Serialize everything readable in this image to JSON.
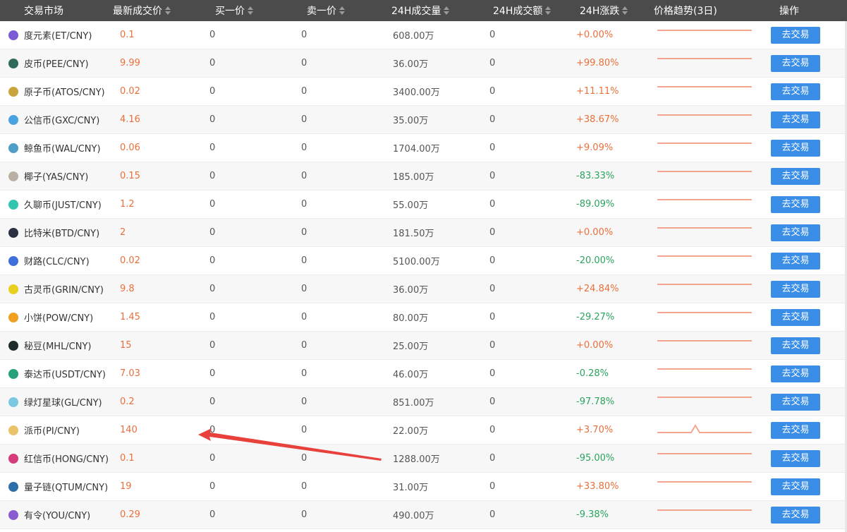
{
  "header": {
    "market": "交易市场",
    "price": "最新成交价",
    "buy": "买一价",
    "sell": "卖一价",
    "volume": "24H成交量",
    "amount": "24H成交额",
    "change": "24H涨跌",
    "trend": "价格趋势(3日)",
    "op": "操作"
  },
  "button_label": "去交易",
  "colors": {
    "header_bg": "#4b4b4b",
    "price": "#e9703c",
    "up": "#e9703c",
    "down": "#2ba35f",
    "button": "#3a8ee6",
    "sparkline": "#f4a58e",
    "arrow": "#e8403a"
  },
  "rows": [
    {
      "name": "度元素(ET/CNY)",
      "icon": "et-coin-icon",
      "icon_color": "#7b5cd6",
      "price": "0.1",
      "buy": "0",
      "sell": "0",
      "volume": "608.00万",
      "amount": "0",
      "change": "+0.00%",
      "dir": "up",
      "spike": false
    },
    {
      "name": "皮币(PEE/CNY)",
      "icon": "pee-coin-icon",
      "icon_color": "#2f6b5a",
      "price": "9.99",
      "buy": "0",
      "sell": "0",
      "volume": "36.00万",
      "amount": "0",
      "change": "+99.80%",
      "dir": "up",
      "spike": false
    },
    {
      "name": "原子币(ATOS/CNY)",
      "icon": "atos-coin-icon",
      "icon_color": "#c9a33b",
      "price": "0.02",
      "buy": "0",
      "sell": "0",
      "volume": "3400.00万",
      "amount": "0",
      "change": "+11.11%",
      "dir": "up",
      "spike": false
    },
    {
      "name": "公信币(GXC/CNY)",
      "icon": "gxc-coin-icon",
      "icon_color": "#4aa3df",
      "price": "4.16",
      "buy": "0",
      "sell": "0",
      "volume": "35.00万",
      "amount": "0",
      "change": "+38.67%",
      "dir": "up",
      "spike": false
    },
    {
      "name": "鲸鱼币(WAL/CNY)",
      "icon": "wal-coin-icon",
      "icon_color": "#4f9ec7",
      "price": "0.06",
      "buy": "0",
      "sell": "0",
      "volume": "1704.00万",
      "amount": "0",
      "change": "+9.09%",
      "dir": "up",
      "spike": false
    },
    {
      "name": "椰子(YAS/CNY)",
      "icon": "yas-coin-icon",
      "icon_color": "#b8b0a2",
      "price": "0.15",
      "buy": "0",
      "sell": "0",
      "volume": "185.00万",
      "amount": "0",
      "change": "-83.33%",
      "dir": "down",
      "spike": false
    },
    {
      "name": "久聊币(JUST/CNY)",
      "icon": "just-coin-icon",
      "icon_color": "#34c5b0",
      "price": "1.2",
      "buy": "0",
      "sell": "0",
      "volume": "55.00万",
      "amount": "0",
      "change": "-89.09%",
      "dir": "down",
      "spike": false
    },
    {
      "name": "比特米(BTD/CNY)",
      "icon": "btd-coin-icon",
      "icon_color": "#2b3140",
      "price": "2",
      "buy": "0",
      "sell": "0",
      "volume": "181.50万",
      "amount": "0",
      "change": "+0.00%",
      "dir": "up",
      "spike": false
    },
    {
      "name": "财路(CLC/CNY)",
      "icon": "clc-coin-icon",
      "icon_color": "#3f6fd8",
      "price": "0.02",
      "buy": "0",
      "sell": "0",
      "volume": "5100.00万",
      "amount": "0",
      "change": "-20.00%",
      "dir": "down",
      "spike": false
    },
    {
      "name": "古灵币(GRIN/CNY)",
      "icon": "grin-coin-icon",
      "icon_color": "#e8d020",
      "price": "9.8",
      "buy": "0",
      "sell": "0",
      "volume": "36.00万",
      "amount": "0",
      "change": "+24.84%",
      "dir": "up",
      "spike": false
    },
    {
      "name": "小饼(POW/CNY)",
      "icon": "pow-coin-icon",
      "icon_color": "#f0a020",
      "price": "1.45",
      "buy": "0",
      "sell": "0",
      "volume": "80.00万",
      "amount": "0",
      "change": "-29.27%",
      "dir": "down",
      "spike": false
    },
    {
      "name": "秘豆(MHL/CNY)",
      "icon": "mhl-coin-icon",
      "icon_color": "#1d2b2a",
      "price": "15",
      "buy": "0",
      "sell": "0",
      "volume": "25.00万",
      "amount": "0",
      "change": "+0.00%",
      "dir": "up",
      "spike": false
    },
    {
      "name": "泰达币(USDT/CNY)",
      "icon": "usdt-coin-icon",
      "icon_color": "#26a17b",
      "price": "7.03",
      "buy": "0",
      "sell": "0",
      "volume": "46.00万",
      "amount": "0",
      "change": "-0.28%",
      "dir": "down",
      "spike": false
    },
    {
      "name": "绿灯星球(GL/CNY)",
      "icon": "gl-coin-icon",
      "icon_color": "#7cc8e0",
      "price": "0.2",
      "buy": "0",
      "sell": "0",
      "volume": "851.00万",
      "amount": "0",
      "change": "-97.78%",
      "dir": "down",
      "spike": false
    },
    {
      "name": "派币(PI/CNY)",
      "icon": "pi-coin-icon",
      "icon_color": "#e8c36a",
      "price": "140",
      "buy": "0",
      "sell": "0",
      "volume": "22.00万",
      "amount": "0",
      "change": "+3.70%",
      "dir": "up",
      "spike": true
    },
    {
      "name": "红信币(HONG/CNY)",
      "icon": "hong-coin-icon",
      "icon_color": "#d63c7a",
      "price": "0.1",
      "buy": "0",
      "sell": "0",
      "volume": "1288.00万",
      "amount": "0",
      "change": "-95.00%",
      "dir": "down",
      "spike": false
    },
    {
      "name": "量子链(QTUM/CNY)",
      "icon": "qtum-coin-icon",
      "icon_color": "#2e6ea8",
      "price": "19",
      "buy": "0",
      "sell": "0",
      "volume": "31.00万",
      "amount": "0",
      "change": "+33.80%",
      "dir": "up",
      "spike": false
    },
    {
      "name": "有令(YOU/CNY)",
      "icon": "you-coin-icon",
      "icon_color": "#8a5bd0",
      "price": "0.29",
      "buy": "0",
      "sell": "0",
      "volume": "490.00万",
      "amount": "0",
      "change": "-9.38%",
      "dir": "down",
      "spike": false
    }
  ]
}
